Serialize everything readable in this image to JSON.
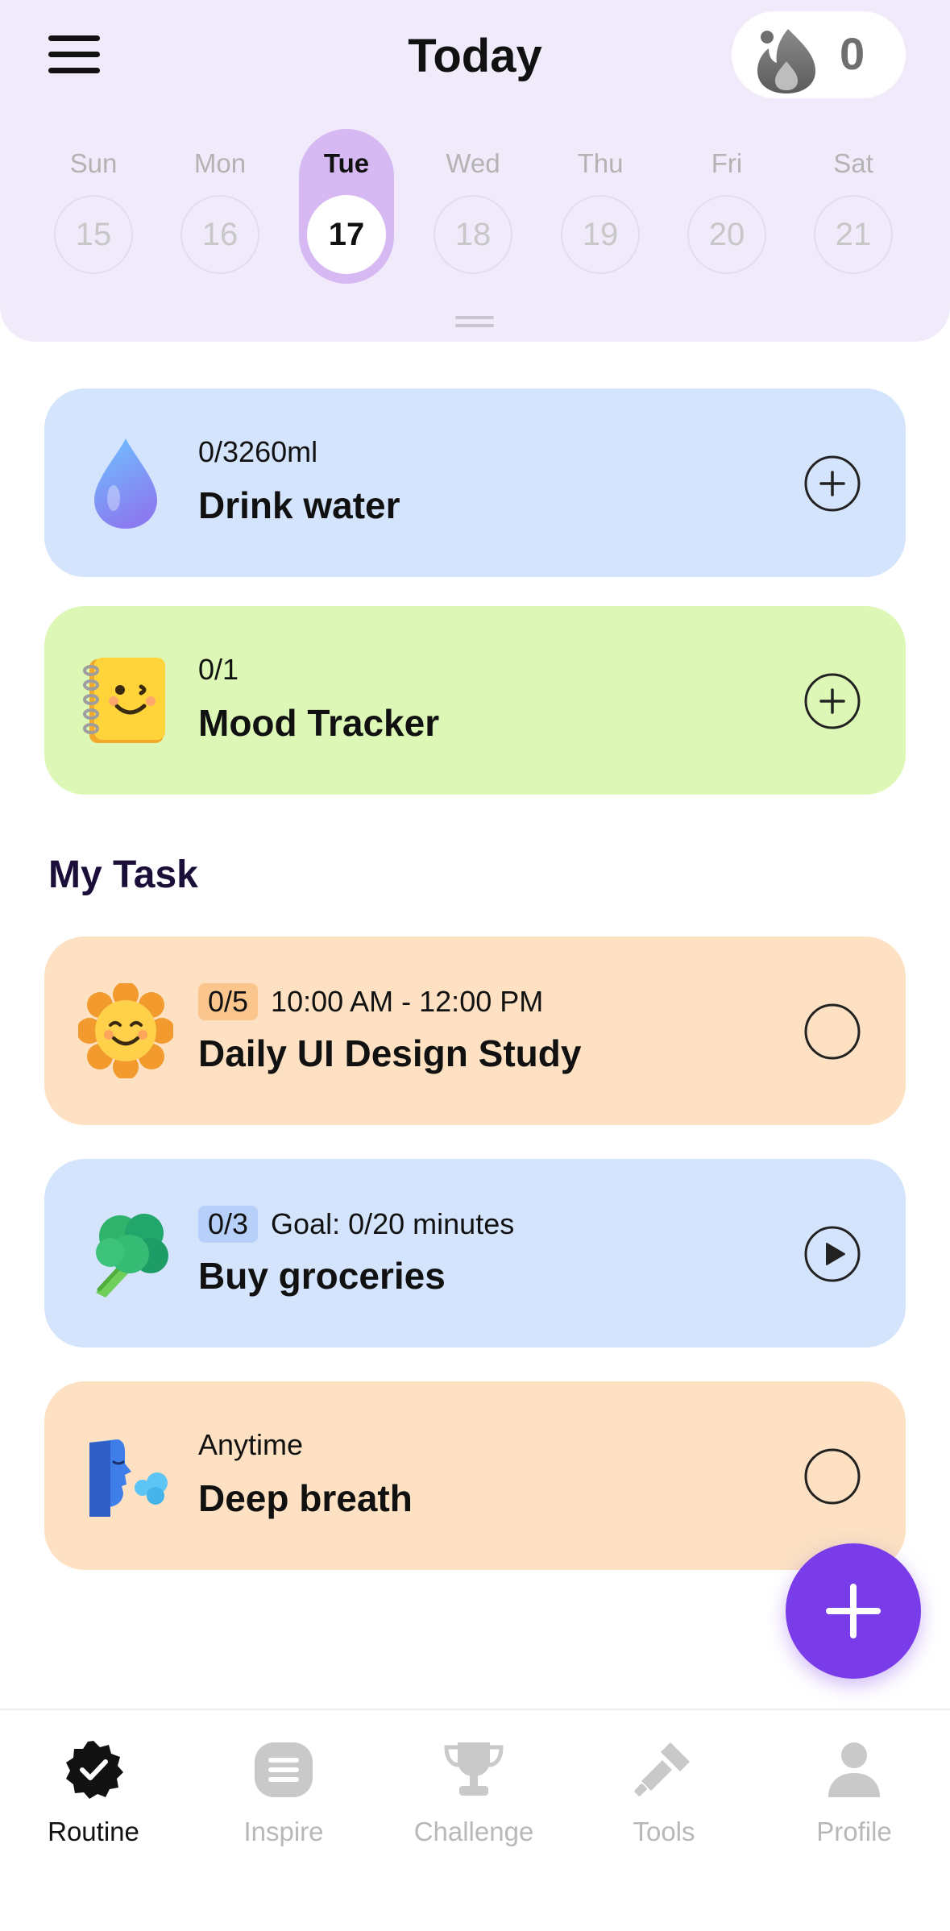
{
  "header": {
    "title": "Today",
    "streak_count": "0",
    "menu_icon": "hamburger-menu-icon",
    "streak_icon": "flame-icon"
  },
  "week": {
    "days": [
      {
        "name": "Sun",
        "date": "15"
      },
      {
        "name": "Mon",
        "date": "16"
      },
      {
        "name": "Tue",
        "date": "17"
      },
      {
        "name": "Wed",
        "date": "18"
      },
      {
        "name": "Thu",
        "date": "19"
      },
      {
        "name": "Fri",
        "date": "20"
      },
      {
        "name": "Sat",
        "date": "21"
      }
    ],
    "selected": "Tue"
  },
  "habits": [
    {
      "progress": "0/3260ml",
      "name": "Drink water",
      "icon": "water-drop-icon",
      "action_icon": "add-circle-icon",
      "color": "#d3e4fc"
    },
    {
      "progress": "0/1",
      "name": "Mood Tracker",
      "icon": "notebook-emoji-icon",
      "action_icon": "add-circle-icon",
      "color": "#ddf8b6"
    }
  ],
  "my_task": {
    "title": "My Task",
    "tasks": [
      {
        "badge": "0/5",
        "detail": "10:00 AM - 12:00 PM",
        "name": "Daily UI Design Study",
        "icon": "smiling-sun-icon",
        "action_icon": "checkbox-circle-icon",
        "color": "#fde1c2"
      },
      {
        "badge": "0/3",
        "detail": "Goal: 0/20 minutes",
        "name": "Buy groceries",
        "icon": "broccoli-icon",
        "action_icon": "play-circle-icon",
        "color": "#d3e4fc"
      },
      {
        "detail": "Anytime",
        "name": "Deep breath",
        "icon": "face-exhaling-icon",
        "action_icon": "checkbox-circle-icon",
        "color": "#fde1c2"
      }
    ]
  },
  "fab": {
    "icon": "plus-icon"
  },
  "bottom_nav": {
    "items": [
      {
        "label": "Routine",
        "icon": "check-badge-icon",
        "active": true
      },
      {
        "label": "Inspire",
        "icon": "inspire-icon",
        "active": false
      },
      {
        "label": "Challenge",
        "icon": "trophy-icon",
        "active": false
      },
      {
        "label": "Tools",
        "icon": "tools-icon",
        "active": false
      },
      {
        "label": "Profile",
        "icon": "person-icon",
        "active": false
      }
    ]
  },
  "colors": {
    "accent": "#7a3be8",
    "header_bg": "#f0eafb",
    "selected_day": "#d6b8f3"
  }
}
